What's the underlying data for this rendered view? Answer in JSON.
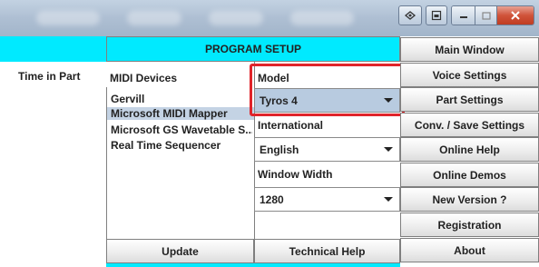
{
  "window": {
    "controls": {
      "icon1": "diamond-icon",
      "icon2": "document-icon",
      "minimize": "minimize-icon",
      "maximize": "maximize-icon",
      "close": "close-icon"
    }
  },
  "header": {
    "title": "PROGRAM SETUP"
  },
  "left": {
    "time_in_part": "Time in Part"
  },
  "midi": {
    "label": "MIDI Devices",
    "devices": [
      "Gervill",
      "Microsoft MIDI Mapper",
      "Microsoft GS Wavetable S...",
      "Real Time Sequencer"
    ],
    "selected": "Microsoft MIDI Mapper"
  },
  "model": {
    "label": "Model",
    "value": "Tyros 4"
  },
  "international": {
    "label": "International",
    "value": "English"
  },
  "window_width": {
    "label": "Window Width",
    "value": "1280"
  },
  "side_buttons": [
    "Main Window",
    "Voice Settings",
    "Part Settings",
    "Conv. / Save Settings",
    "Online Help",
    "Online Demos",
    "New Version ?",
    "Registration",
    "About"
  ],
  "bottom_buttons": {
    "update": "Update",
    "technical_help": "Technical Help"
  },
  "colors": {
    "cyan": "#00eaff",
    "highlight": "#e0242a",
    "selection": "#c4d3e4"
  }
}
